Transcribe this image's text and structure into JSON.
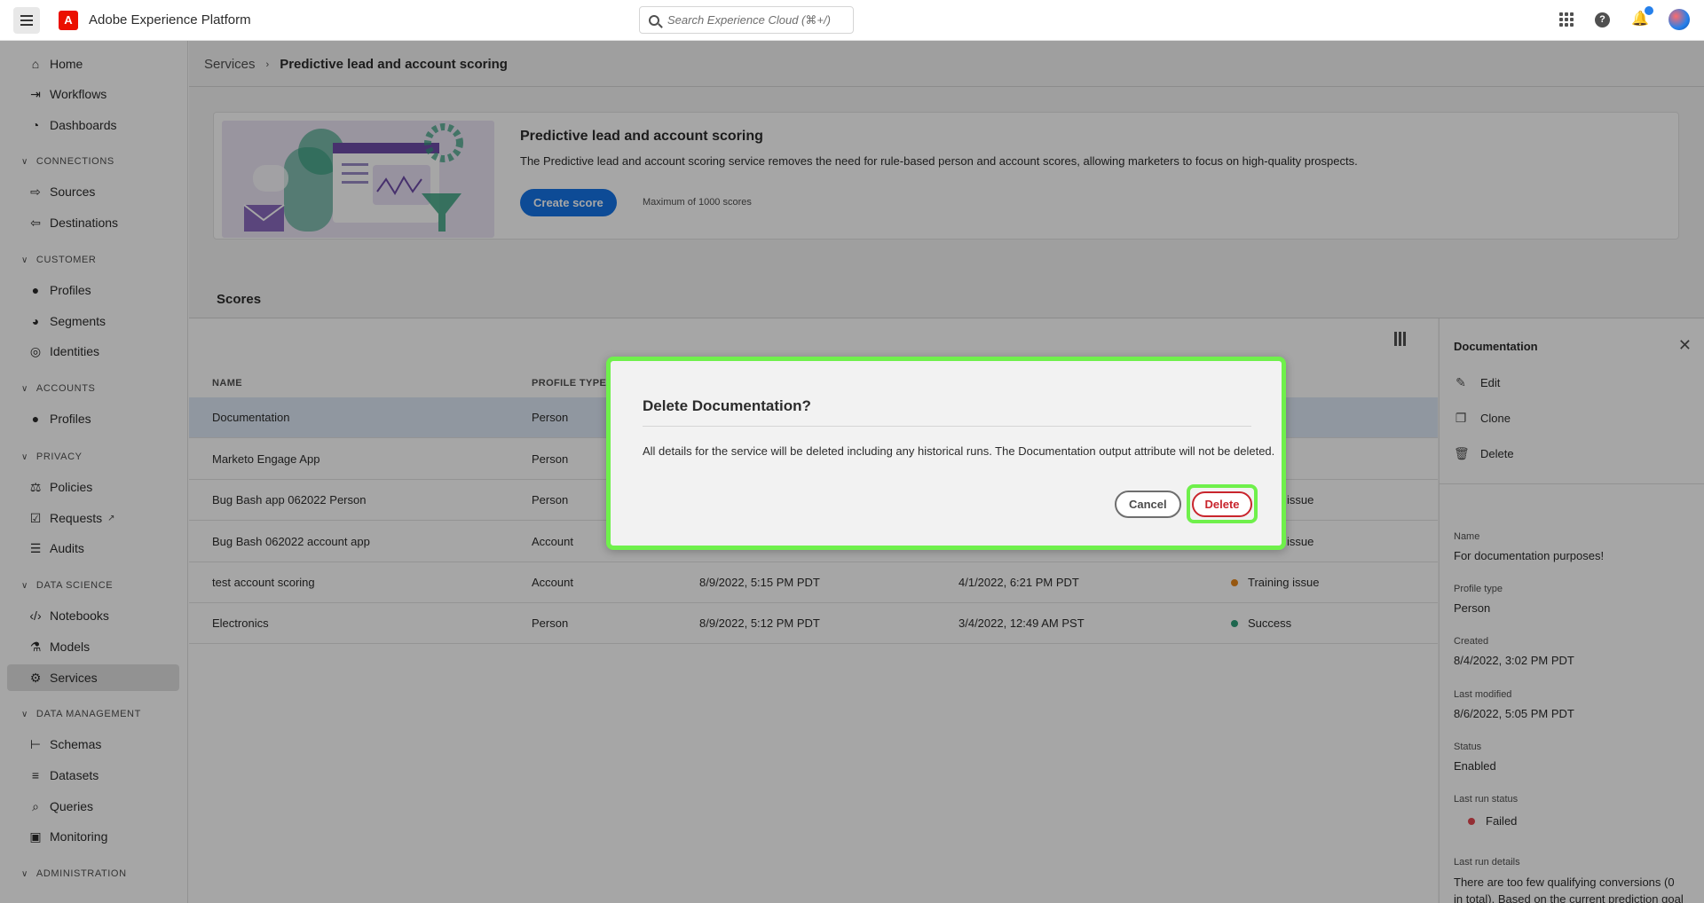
{
  "app": {
    "title": "Adobe Experience Platform",
    "logo_letter": "A"
  },
  "search": {
    "placeholder": "Search Experience Cloud (⌘+/)"
  },
  "sidebar": {
    "home": "Home",
    "workflows": "Workflows",
    "dashboards": "Dashboards",
    "connections": "CONNECTIONS",
    "sources": "Sources",
    "destinations": "Destinations",
    "customer": "CUSTOMER",
    "profiles": "Profiles",
    "segments": "Segments",
    "identities": "Identities",
    "accounts": "ACCOUNTS",
    "account_profiles": "Profiles",
    "privacy": "PRIVACY",
    "policies": "Policies",
    "requests": "Requests",
    "audits": "Audits",
    "data_science": "DATA SCIENCE",
    "notebooks": "Notebooks",
    "models": "Models",
    "services": "Services",
    "data_management": "DATA MANAGEMENT",
    "schemas": "Schemas",
    "datasets": "Datasets",
    "queries": "Queries",
    "monitoring": "Monitoring",
    "administration": "ADMINISTRATION"
  },
  "breadcrumb": {
    "parent": "Services",
    "current": "Predictive lead and account scoring"
  },
  "hero": {
    "title": "Predictive lead and account scoring",
    "description": "The Predictive lead and account scoring service removes the need for rule-based person and account scores, allowing marketers to focus on high-quality prospects.",
    "create_button": "Create score",
    "max_note": "Maximum of 1000 scores"
  },
  "scores": {
    "title": "Scores",
    "headers": {
      "name": "NAME",
      "profile_type": "PROFILE TYPE"
    },
    "rows": [
      {
        "name": "Documentation",
        "profile_type": "Person",
        "created": "",
        "modified": "",
        "status": ""
      },
      {
        "name": "Marketo Engage App",
        "profile_type": "Person",
        "created": "",
        "modified": "",
        "status": ""
      },
      {
        "name": "Bug Bash app 062022 Person",
        "profile_type": "Person",
        "created": "",
        "modified": "",
        "status": "issue"
      },
      {
        "name": "Bug Bash 062022 account app",
        "profile_type": "Account",
        "created": "",
        "modified": "",
        "status": "issue"
      },
      {
        "name": "test account scoring",
        "profile_type": "Account",
        "created": "8/9/2022, 5:15 PM PDT",
        "modified": "4/1/2022, 6:21 PM PDT",
        "status": "Training issue"
      },
      {
        "name": "Electronics",
        "profile_type": "Person",
        "created": "8/9/2022, 5:12 PM PDT",
        "modified": "3/4/2022, 12:49 AM PST",
        "status": "Success"
      }
    ],
    "status_colors": {
      "issue": "#e68619",
      "success": "#2d9d78",
      "failed": "#e34850"
    }
  },
  "panel": {
    "title": "Documentation",
    "edit": "Edit",
    "clone": "Clone",
    "delete": "Delete",
    "name_label": "Name",
    "name_value": "For documentation purposes!",
    "profile_type_label": "Profile type",
    "profile_type_value": "Person",
    "created_label": "Created",
    "created_value": "8/4/2022, 3:02 PM PDT",
    "modified_label": "Last modified",
    "modified_value": "8/6/2022, 5:05 PM PDT",
    "status_label": "Status",
    "status_value": "Enabled",
    "last_run_status_label": "Last run status",
    "last_run_status_value": "Failed",
    "last_run_details_label": "Last run details",
    "last_run_details_value": "There are too few qualifying conversions (0 in total). Based on the current prediction goal"
  },
  "dialog": {
    "title": "Delete Documentation?",
    "body": "All details for the service will be deleted including any historical runs. The Documentation output attribute will not be deleted.",
    "cancel": "Cancel",
    "delete": "Delete"
  },
  "colors": {
    "accent": "#1473e6",
    "highlight": "#6ff04b",
    "destructive": "#c9252d"
  }
}
